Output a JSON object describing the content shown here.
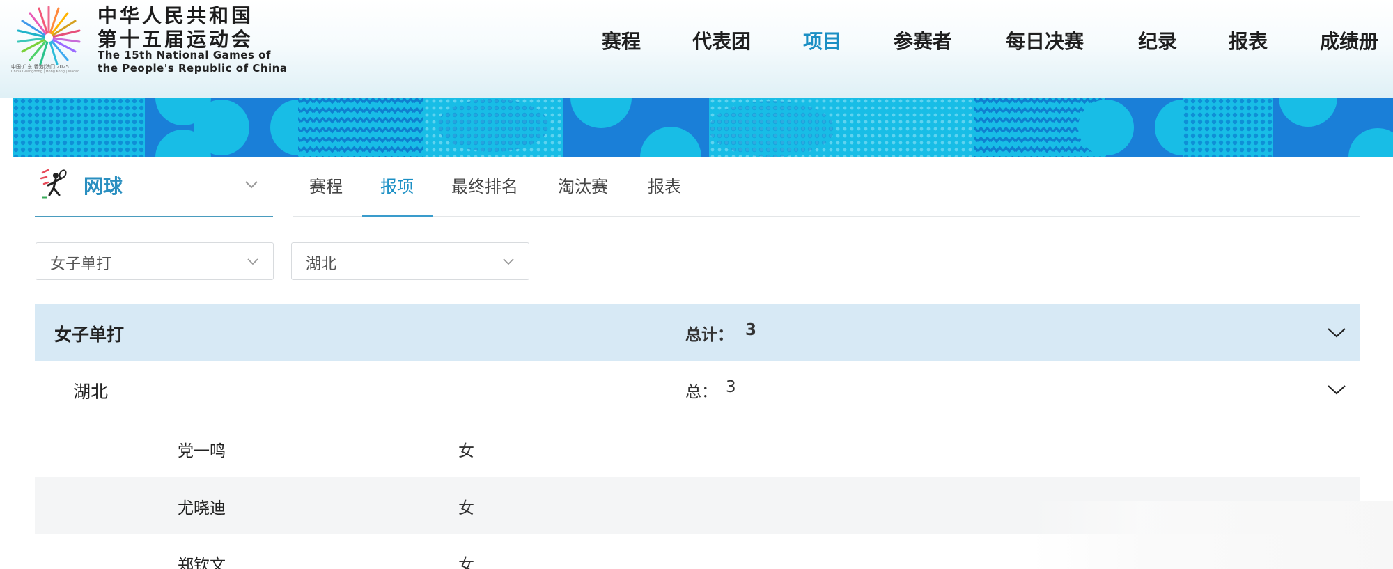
{
  "header": {
    "title_cn_line1": "中华人民共和国",
    "title_cn_line2": "第十五届运动会",
    "title_en_line1": "The 15th National Games of",
    "title_en_line2": "the People's Republic of China",
    "logo_subtext": "中国·广东|香港|澳门 2025",
    "logo_subtext_en": "China Guangdong | Hong Kong | Macao"
  },
  "nav": {
    "items": [
      {
        "label": "赛程",
        "active": false
      },
      {
        "label": "代表团",
        "active": false
      },
      {
        "label": "项目",
        "active": true
      },
      {
        "label": "参赛者",
        "active": false
      },
      {
        "label": "每日决赛",
        "active": false
      },
      {
        "label": "纪录",
        "active": false
      },
      {
        "label": "报表",
        "active": false
      },
      {
        "label": "成绩册",
        "active": false
      }
    ]
  },
  "sport": {
    "name": "网球",
    "icon": "tennis-player-icon"
  },
  "tabs": [
    {
      "label": "赛程",
      "active": false
    },
    {
      "label": "报项",
      "active": true
    },
    {
      "label": "最终排名",
      "active": false
    },
    {
      "label": "淘汰赛",
      "active": false
    },
    {
      "label": "报表",
      "active": false
    }
  ],
  "filters": {
    "event": "女子单打",
    "delegation": "湖北"
  },
  "table": {
    "group_title": "女子单打",
    "group_total_label": "总计：",
    "group_total_value": "3",
    "sub_title": "湖北",
    "sub_total_label": "总：",
    "sub_total_value": "3",
    "rows": [
      {
        "name": "党一鸣",
        "gender": "女"
      },
      {
        "name": "尤晓迪",
        "gender": "女"
      },
      {
        "name": "郑钦文",
        "gender": "女"
      }
    ]
  },
  "colors": {
    "accent": "#1b8fc4",
    "banner": "#17bde6",
    "group_head_bg": "#d7e9f5"
  }
}
